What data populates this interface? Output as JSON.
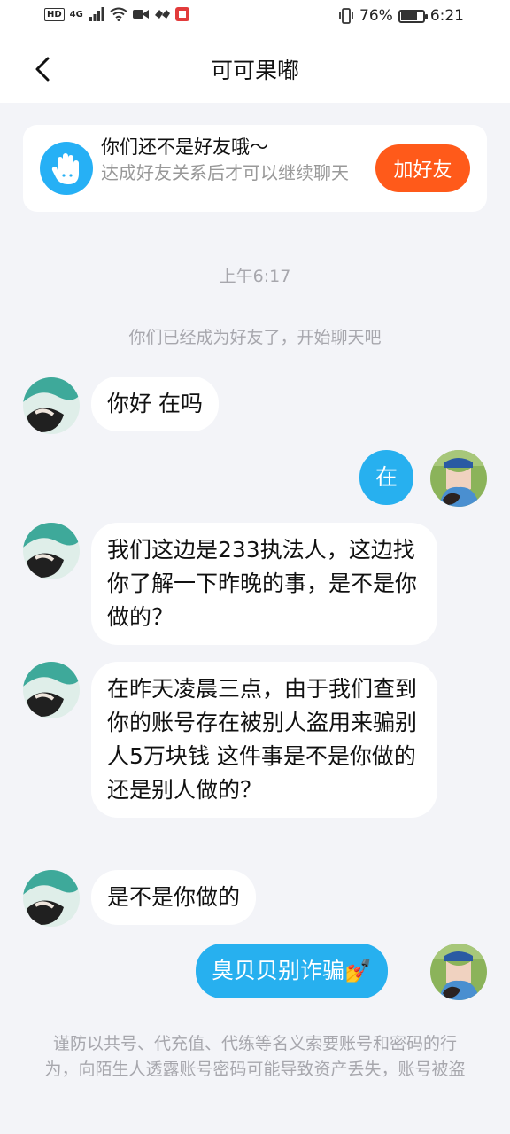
{
  "status_bar": {
    "left_tags": [
      "HD",
      "4G"
    ],
    "battery": "76%",
    "battery_level": 0.76,
    "time": "6:21"
  },
  "nav": {
    "title": "可可果嘟",
    "back_icon": "chevron-left-icon"
  },
  "friend_card": {
    "title": "你们还不是好友哦～",
    "subtitle": "达成好友关系后才可以继续聊天",
    "button": "加好友"
  },
  "chat": {
    "timestamp": "上午6:17",
    "system_notice": "你们已经成为好友了，开始聊天吧",
    "messages": [
      {
        "from": "other",
        "text": "你好 在吗"
      },
      {
        "from": "me",
        "text": "在"
      },
      {
        "from": "other",
        "text": "我们这边是233执法人，这边找你了解一下昨晚的事，是不是你做的？"
      },
      {
        "from": "other",
        "text": "在昨天凌晨三点，由于我们查到你的账号存在被别人盗用来骗别人5万块钱 这件事是不是你做的还是别人做的？"
      },
      {
        "from": "other",
        "text": "是不是你做的"
      },
      {
        "from": "me",
        "text": "臭贝贝别诈骗💅"
      }
    ]
  },
  "warning": "谨防以共号、代充值、代练等名义索要账号和密码的行为，向陌生人透露账号密码可能导致资产丢失，账号被盗",
  "colors": {
    "accent_blue": "#27b0ef",
    "add_button": "#ff5a1a",
    "background": "#f3f4f8"
  }
}
